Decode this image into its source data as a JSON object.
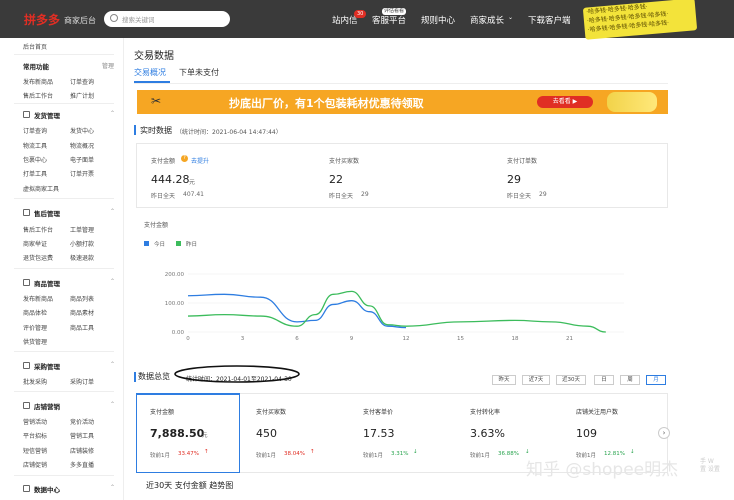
{
  "topbar": {
    "logo": "拼多多",
    "logo_sub": "商家后台",
    "search_placeholder": "搜索关键词",
    "nav": [
      "站内信",
      "客服平台",
      "规则中心",
      "商家成长",
      "下载客户端"
    ],
    "badge_count": "30",
    "badge_new": "评估看看",
    "scribble_lines": [
      "·哈多钱·哈多钱·哈多钱·",
      "·哈多钱·哈多钱·哈多钱·哈多钱·",
      "·哈多钱·哈多钱·哈多钱·哈多钱·"
    ]
  },
  "sidebar": {
    "home": "后台首页",
    "common": "常用功能",
    "manage": "管理",
    "common_items": [
      "发布新商品",
      "订单查询",
      "售后工作台",
      "推广计划"
    ],
    "groups": [
      {
        "title": "发货管理",
        "items": [
          "订单查询",
          "发货中心",
          "物流工具",
          "物流概况",
          "包裹中心",
          "电子面单",
          "打单工具",
          "订单开票",
          "虚拟商家工具"
        ]
      },
      {
        "title": "售后管理",
        "items": [
          "售后工作台",
          "工单管理",
          "商家举证",
          "小额打款",
          "退货包运费",
          "极速退款"
        ]
      },
      {
        "title": "商品管理",
        "items": [
          "发布新商品",
          "商品列表",
          "商品体检",
          "商品素材",
          "评价管理",
          "商品工具",
          "供货管理"
        ]
      },
      {
        "title": "采购管理",
        "items": [
          "批发采购",
          "采购订单"
        ]
      },
      {
        "title": "店铺营销",
        "items": [
          "营销活动",
          "竞价活动",
          "平台招标",
          "营销工具",
          "短信营销",
          "店铺装修",
          "店铺促销",
          "多多直播"
        ]
      },
      {
        "title": "数据中心",
        "items": []
      }
    ]
  },
  "main": {
    "title": "交易数据",
    "tabs": [
      "交易概况",
      "下单未支付"
    ],
    "banner_text": "抄底出厂价，有1个包装耗材优惠待领取",
    "banner_btn": "去看看 ▶",
    "realtime_title": "实时数据",
    "realtime_time": "（统计时间：2021-06-04 14:47:44）",
    "metrics": [
      {
        "label": "支付金额",
        "value": "444.28",
        "unit": "元",
        "sub_label": "昨日全天",
        "sub_value": "407.41",
        "extra": "去提升"
      },
      {
        "label": "支付买家数",
        "value": "22",
        "unit": "",
        "sub_label": "昨日全天",
        "sub_value": "29",
        "extra": ""
      },
      {
        "label": "支付订单数",
        "value": "29",
        "unit": "",
        "sub_label": "昨日全天",
        "sub_value": "29",
        "extra": ""
      }
    ],
    "chart_label": "支付金额",
    "legend": [
      "今日",
      "昨日"
    ],
    "overview_title": "数据总览",
    "overview_time": "统计时间：2021-04-01至2021-04-30",
    "ranges": [
      "昨天",
      "近7天",
      "近30天",
      "日",
      "周",
      "月"
    ],
    "overview": [
      {
        "label": "支付金额",
        "value": "7,888.50",
        "unit": "元",
        "cmp": "较前1月",
        "pct": "33.47%",
        "dir": "up"
      },
      {
        "label": "支付买家数",
        "value": "450",
        "unit": "",
        "cmp": "较前1月",
        "pct": "38.04%",
        "dir": "up"
      },
      {
        "label": "支付客单价",
        "value": "17.53",
        "unit": "",
        "cmp": "较前1月",
        "pct": "3.31%",
        "dir": "down"
      },
      {
        "label": "支付转化率",
        "value": "3.63%",
        "unit": "",
        "cmp": "较前1月",
        "pct": "36.88%",
        "dir": "down"
      },
      {
        "label": "店铺关注用户数",
        "value": "109",
        "unit": "",
        "cmp": "较前1月",
        "pct": "12.81%",
        "dir": "down"
      }
    ],
    "trend_title": "近30天 支付金额 趋势图",
    "watermark": "知乎 @shopee明杰",
    "watermark_side": [
      "手 W",
      "置 设置"
    ]
  },
  "chart_data": {
    "type": "line",
    "x": [
      0,
      3,
      6,
      9,
      12,
      15,
      18,
      21
    ],
    "xticks": [
      "0",
      "3",
      "6",
      "9",
      "12",
      "15",
      "18",
      "21"
    ],
    "yticks": [
      "200.00",
      "100.00",
      "0.00"
    ],
    "ylim": [
      0,
      200
    ],
    "series": [
      {
        "name": "今日",
        "color": "#2e7de1",
        "points": [
          [
            0,
            125
          ],
          [
            2,
            130
          ],
          [
            4,
            120
          ],
          [
            6,
            35
          ],
          [
            7,
            40
          ],
          [
            8,
            95
          ],
          [
            9,
            108
          ],
          [
            10,
            70
          ],
          [
            11,
            20
          ],
          [
            12,
            15
          ]
        ]
      },
      {
        "name": "昨日",
        "color": "#3cbc5c",
        "points": [
          [
            0,
            55
          ],
          [
            2,
            60
          ],
          [
            4,
            55
          ],
          [
            6,
            20
          ],
          [
            7,
            60
          ],
          [
            8,
            130
          ],
          [
            9,
            140
          ],
          [
            10,
            90
          ],
          [
            11,
            25
          ],
          [
            12,
            20
          ],
          [
            15,
            35
          ],
          [
            18,
            40
          ],
          [
            20,
            35
          ],
          [
            22,
            20
          ],
          [
            23,
            0
          ]
        ]
      }
    ]
  }
}
